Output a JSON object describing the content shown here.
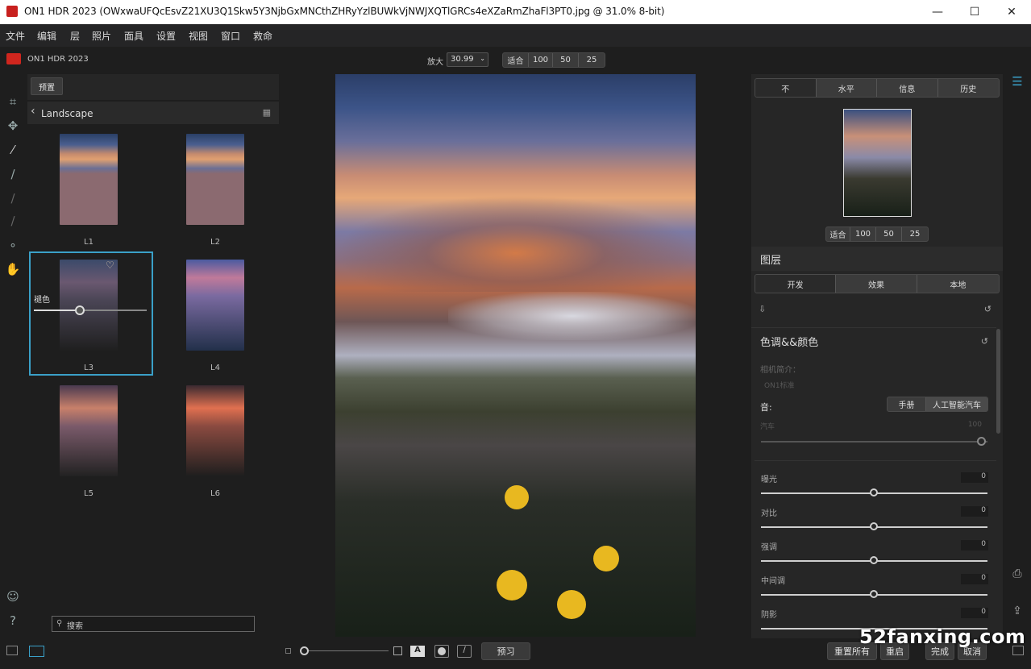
{
  "window": {
    "title": "ON1 HDR 2023 (OWxwaUFQcEsvZ21XU3Q1Skw5Y3NjbGxMNCthZHRyYzlBUWkVjNWJXQTlGRCs4eXZaRmZhaFl3PT0.jpg @ 31.0% 8-bit)",
    "minimize": "—",
    "maximize": "☐",
    "close": "✕"
  },
  "menu": [
    "文件",
    "编辑",
    "层",
    "照片",
    "面具",
    "设置",
    "视图",
    "窗口",
    "救命"
  ],
  "app_name": "ON1 HDR 2023",
  "zoom": {
    "label": "放大",
    "value": "30.99",
    "presets": [
      "适合",
      "100",
      "50",
      "25"
    ]
  },
  "browser": {
    "preset_button": "预置",
    "category": "Landscape",
    "thumbs": [
      {
        "label": "L1"
      },
      {
        "label": "L2"
      },
      {
        "label": "L3",
        "selected": true,
        "fade_label": "褪色",
        "fade_value": 0.4
      },
      {
        "label": "L4"
      },
      {
        "label": "L5"
      },
      {
        "label": "L6"
      }
    ],
    "search_placeholder": "搜索"
  },
  "bottom": {
    "preview_button": "预习",
    "reset_all": "重置所有",
    "reset": "重启",
    "done": "完成",
    "cancel": "取消"
  },
  "right": {
    "nav_tabs": [
      "不",
      "水平",
      "信息",
      "历史"
    ],
    "nav_zoom": [
      "适合",
      "100",
      "50",
      "25"
    ],
    "layers_title": "图层",
    "module_tabs": [
      "开发",
      "效果",
      "本地"
    ],
    "section_title": "色调&&颜色",
    "camera_profile_label": "相机简介：",
    "camera_profile_value": "ON1标准",
    "tone_label": "音:",
    "tone_modes": [
      "手册",
      "人工智能汽车"
    ],
    "auto_label": "汽车",
    "auto_value": "100",
    "sliders": [
      {
        "label": "曝光",
        "value": "0"
      },
      {
        "label": "对比",
        "value": "0"
      },
      {
        "label": "强调",
        "value": "0"
      },
      {
        "label": "中间调",
        "value": "0"
      },
      {
        "label": "阴影",
        "value": "0"
      }
    ]
  },
  "watermark": "52fanxing.com",
  "colors": {
    "accent": "#3aa0c8",
    "panel": "#262626",
    "background": "#1e1e1e"
  }
}
